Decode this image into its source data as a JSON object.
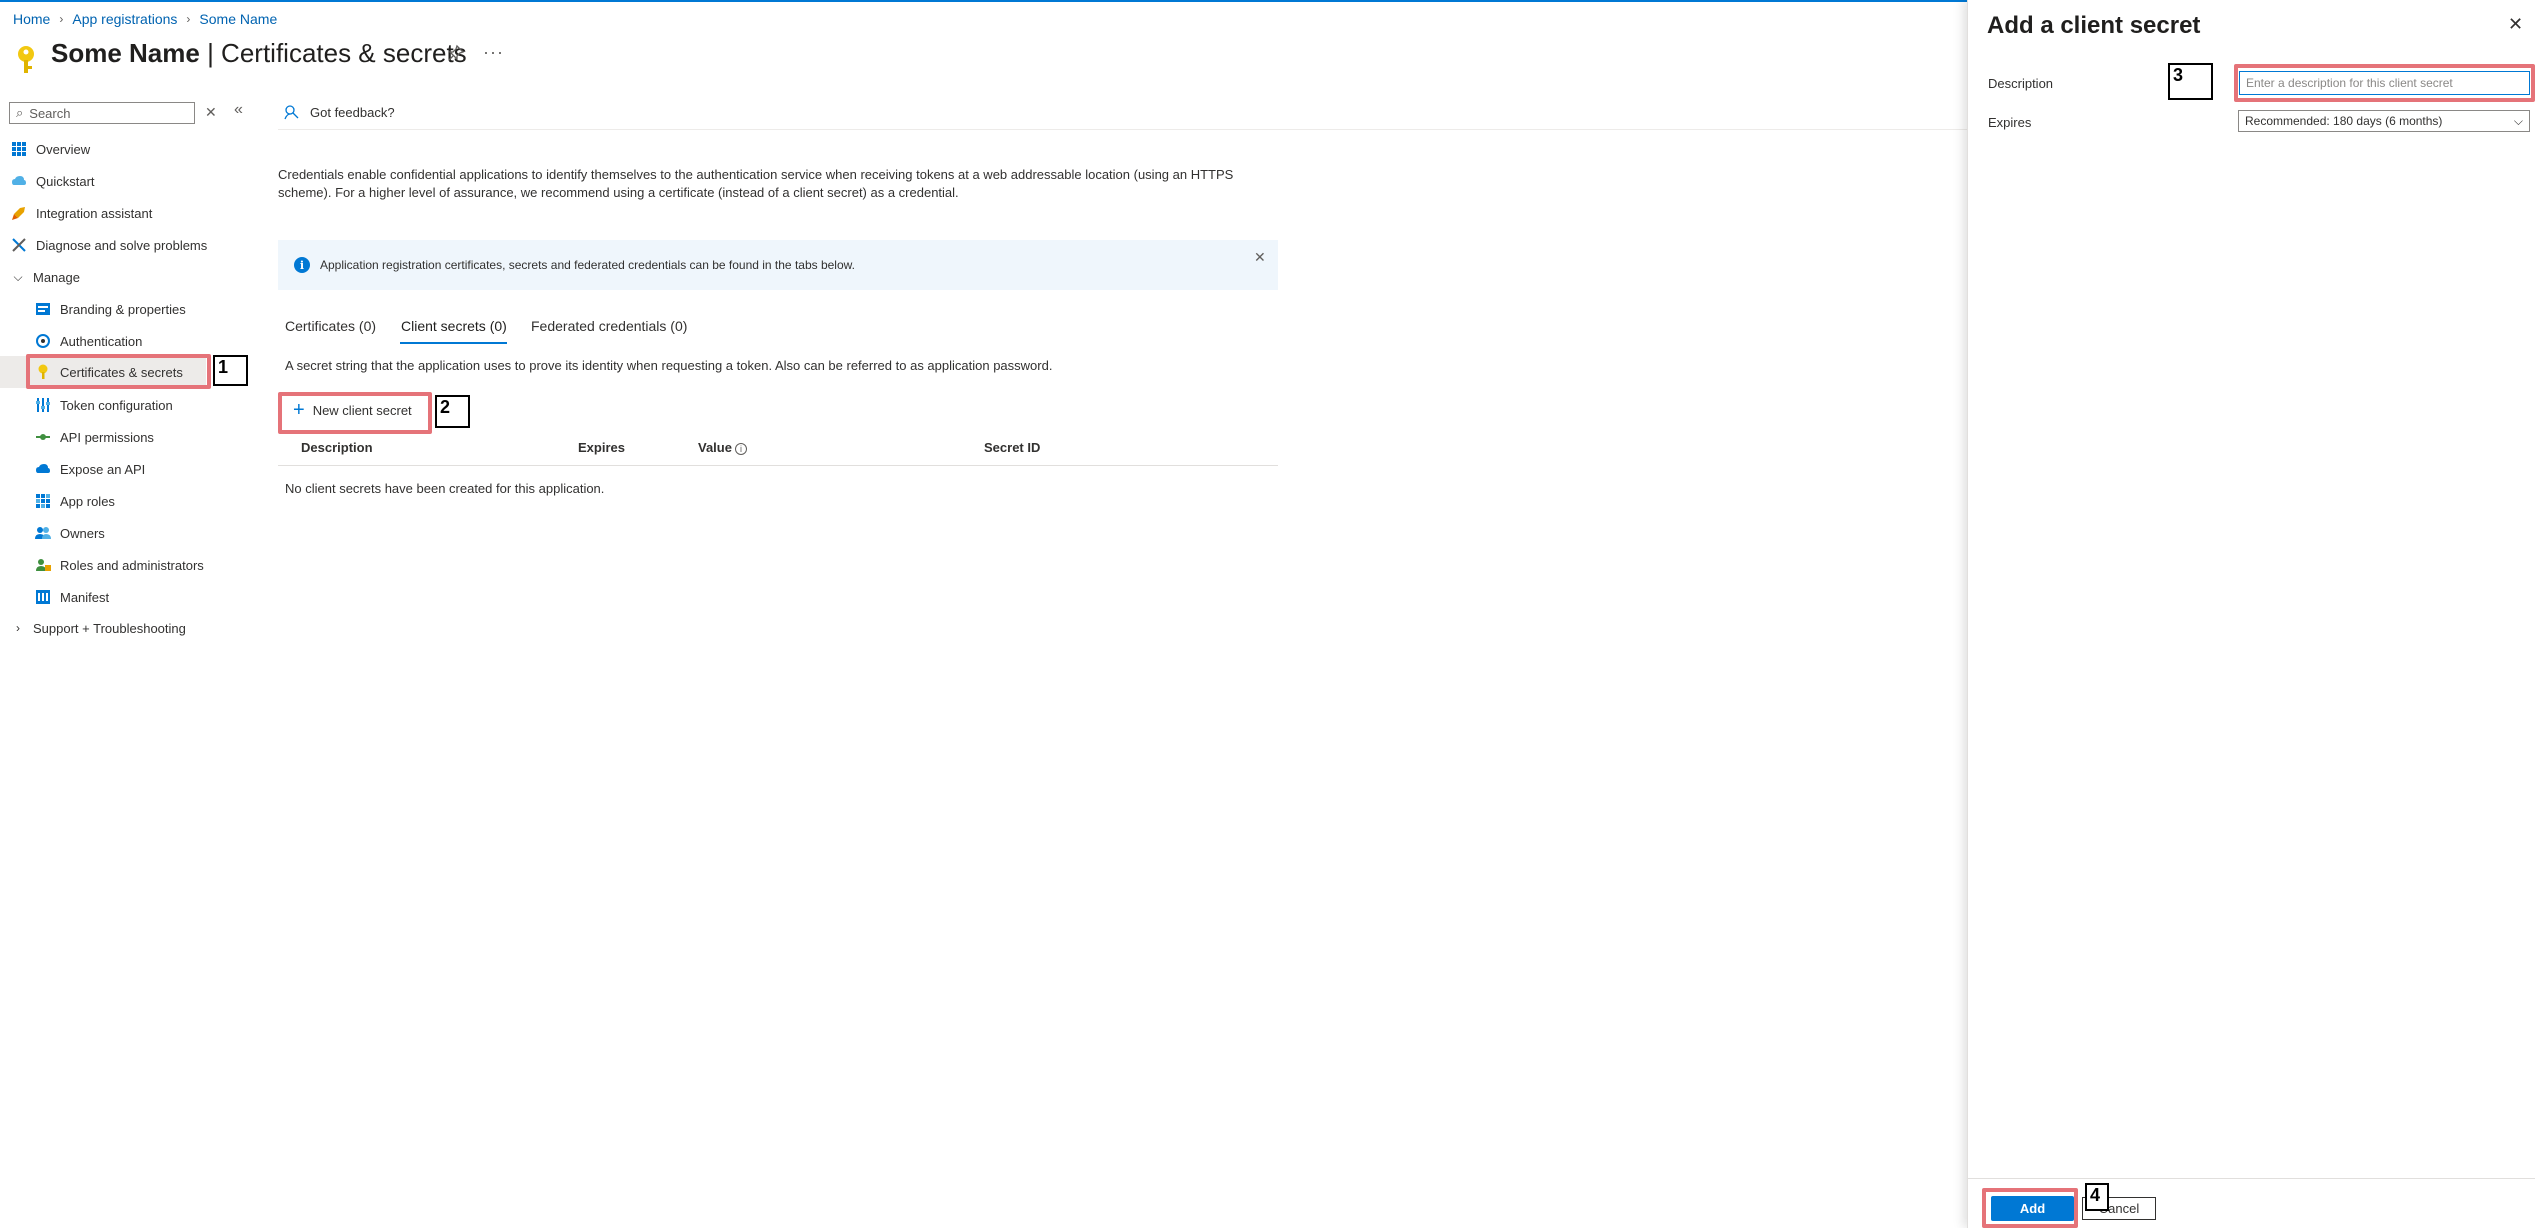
{
  "breadcrumb": [
    "Home",
    "App registrations",
    "Some Name"
  ],
  "header": {
    "title_bold": "Some Name",
    "title_sep": " | ",
    "title_rest": "Certificates & secrets",
    "more": "···"
  },
  "search": {
    "placeholder": "Search"
  },
  "sidebar": {
    "items": [
      {
        "label": "Overview",
        "icon": "overview-icon"
      },
      {
        "label": "Quickstart",
        "icon": "quickstart-icon"
      },
      {
        "label": "Integration assistant",
        "icon": "rocket-icon"
      },
      {
        "label": "Diagnose and solve problems",
        "icon": "wrench-icon"
      },
      {
        "label": "Manage",
        "icon": "chevron-down-icon"
      },
      {
        "label": "Branding & properties",
        "icon": "branding-icon"
      },
      {
        "label": "Authentication",
        "icon": "authentication-icon"
      },
      {
        "label": "Certificates & secrets",
        "icon": "key-icon"
      },
      {
        "label": "Token configuration",
        "icon": "token-icon"
      },
      {
        "label": "API permissions",
        "icon": "api-permissions-icon"
      },
      {
        "label": "Expose an API",
        "icon": "cloud-icon"
      },
      {
        "label": "App roles",
        "icon": "app-roles-icon"
      },
      {
        "label": "Owners",
        "icon": "owners-icon"
      },
      {
        "label": "Roles and administrators",
        "icon": "roles-icon"
      },
      {
        "label": "Manifest",
        "icon": "manifest-icon"
      },
      {
        "label": "Support + Troubleshooting",
        "icon": "chevron-right-icon"
      }
    ]
  },
  "toolbar": {
    "feedback": "Got feedback?"
  },
  "main": {
    "intro": "Credentials enable confidential applications to identify themselves to the authentication service when receiving tokens at a web addressable location (using an HTTPS scheme). For a higher level of assurance, we recommend using a certificate (instead of a client secret) as a credential.",
    "info": "Application registration certificates, secrets and federated credentials can be found in the tabs below.",
    "tabs": [
      "Certificates (0)",
      "Client secrets (0)",
      "Federated credentials (0)"
    ],
    "secret_desc": "A secret string that the application uses to prove its identity when requesting a token. Also can be referred to as application password.",
    "new_button": "New client secret",
    "columns": [
      "Description",
      "Expires",
      "Value",
      "Secret ID"
    ],
    "empty": "No client secrets have been created for this application."
  },
  "panel": {
    "title": "Add a client secret",
    "description_label": "Description",
    "description_placeholder": "Enter a description for this client secret",
    "expires_label": "Expires",
    "expires_value": "Recommended: 180 days (6 months)",
    "add": "Add",
    "cancel": "Cancel"
  },
  "annotations": [
    "1",
    "2",
    "3",
    "4"
  ],
  "colors": {
    "accent": "#0078d4",
    "highlight": "#e57379",
    "key_gold": "#f2c811"
  }
}
